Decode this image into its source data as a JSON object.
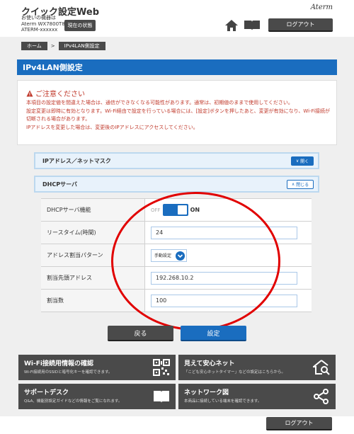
{
  "header": {
    "app_title": "クイック設定Web",
    "model_label": "お使いの機器は",
    "model_name": "Aterm WX7800T8",
    "device_id": "ATERM-xxxxxx",
    "status_button": "現在の状態",
    "brand": "Aterm",
    "logout": "ログアウト"
  },
  "breadcrumb": {
    "home": "ホーム",
    "separator": ">",
    "current": "IPv4LAN側設定"
  },
  "page": {
    "title": "IPv4LAN側設定"
  },
  "caution": {
    "title": "ご注意ください",
    "lines": [
      "本項目の設定値を間違えた場合は、通信ができなくなる可能性があります。通常は、初期値のままで使用してください。",
      "設定変更は即時に有効となります。Wi-Fi経由で設定を行っている場合には、[設定]ボタンを押したあと、変更が有効になり、Wi-Fi接続が切断される場合があります。",
      "IPアドレスを変更した場合は、変更後のIPアドレスにアクセスしてください。"
    ]
  },
  "sections": {
    "ip_mask": {
      "label": "IPアドレス／ネットマスク",
      "toggle": "開く"
    },
    "dhcp": {
      "label": "DHCPサーバ",
      "toggle": "閉じる"
    }
  },
  "form": {
    "dhcp_function": {
      "label": "DHCPサーバ機能",
      "off": "OFF",
      "on": "ON",
      "state": "on"
    },
    "lease_time": {
      "label": "リースタイム(時間)",
      "value": "24"
    },
    "assign_pattern": {
      "label": "アドレス割当パターン",
      "value": "手動設定"
    },
    "start_address": {
      "label": "割当先頭アドレス",
      "value": "192.268.10.2"
    },
    "count": {
      "label": "割当数",
      "value": "100"
    }
  },
  "buttons": {
    "back": "戻る",
    "save": "設定"
  },
  "tiles": [
    {
      "title": "Wi-Fi接続用情報の確認",
      "desc": "Wi-Fi接続用のSSIDと暗号化キーを確認できます。",
      "icon": "qr-code-icon"
    },
    {
      "title": "見えて安心ネット",
      "desc": "「こども安心ネットタイマー」などの設定はこちらから。",
      "icon": "home-search-icon"
    },
    {
      "title": "サポートデスク",
      "desc": "Q&A、機能別設定ガイドなどの情報をご覧になれます。",
      "icon": "book-icon"
    },
    {
      "title": "ネットワーク図",
      "desc": "本商品に接続している端末を確認できます。",
      "icon": "network-icon"
    }
  ],
  "footer": {
    "logout": "ログアウト"
  },
  "colors": {
    "accent_blue": "#1a6dbf",
    "dark_button": "#4a4a4a",
    "warning_red": "#c0392b",
    "highlight_circle": "#e10000"
  }
}
